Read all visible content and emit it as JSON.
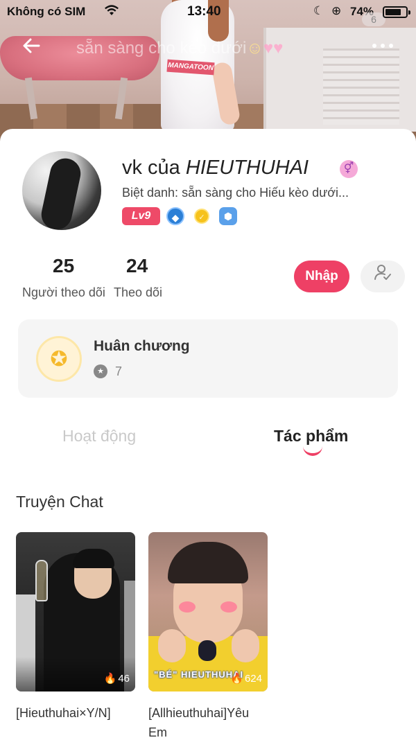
{
  "status_bar": {
    "carrier": "Không có SIM",
    "time": "13:40",
    "battery_percent": "74%",
    "notification_count": "6"
  },
  "banner": {
    "watermark": "sẵn sàng cho kèo dưới",
    "shirt_logo": "MANGATOON"
  },
  "profile": {
    "name_prefix": "vk của ",
    "name_highlight": "HIEUTHUHAI",
    "gender_symbol": "⚥",
    "nickname": "Biệt danh: sẵn sàng cho Hiếu kèo dưới...",
    "level": "Lv9",
    "stats": [
      {
        "value": "25",
        "label": "Người theo dõi"
      },
      {
        "value": "24",
        "label": "Theo dõi"
      }
    ],
    "follow_label": "Nhập"
  },
  "medals": {
    "title": "Huân chương",
    "count": "7"
  },
  "tabs": [
    {
      "label": "Hoạt động",
      "active": false
    },
    {
      "label": "Tác phẩm",
      "active": true
    }
  ],
  "section_title": "Truyện Chat",
  "works": [
    {
      "title": "[Hieuthuhai×Y/N]",
      "views": "46",
      "caption": ""
    },
    {
      "title": "[Allhieuthuhai]Yêu Em",
      "views": "624",
      "caption": "\"BÉ\" HIEUTHUHAI"
    }
  ],
  "colors": {
    "accent": "#ee4065",
    "level_badge": "#ee4a68",
    "inactive_tab": "#c9c9c9"
  },
  "icons": [
    "back-arrow-icon",
    "more-dots-icon",
    "wifi-icon",
    "moon-icon",
    "orientation-lock-icon",
    "battery-icon",
    "gender-icon",
    "user-check-icon",
    "medal-icon",
    "star-icon",
    "flame-icon"
  ]
}
